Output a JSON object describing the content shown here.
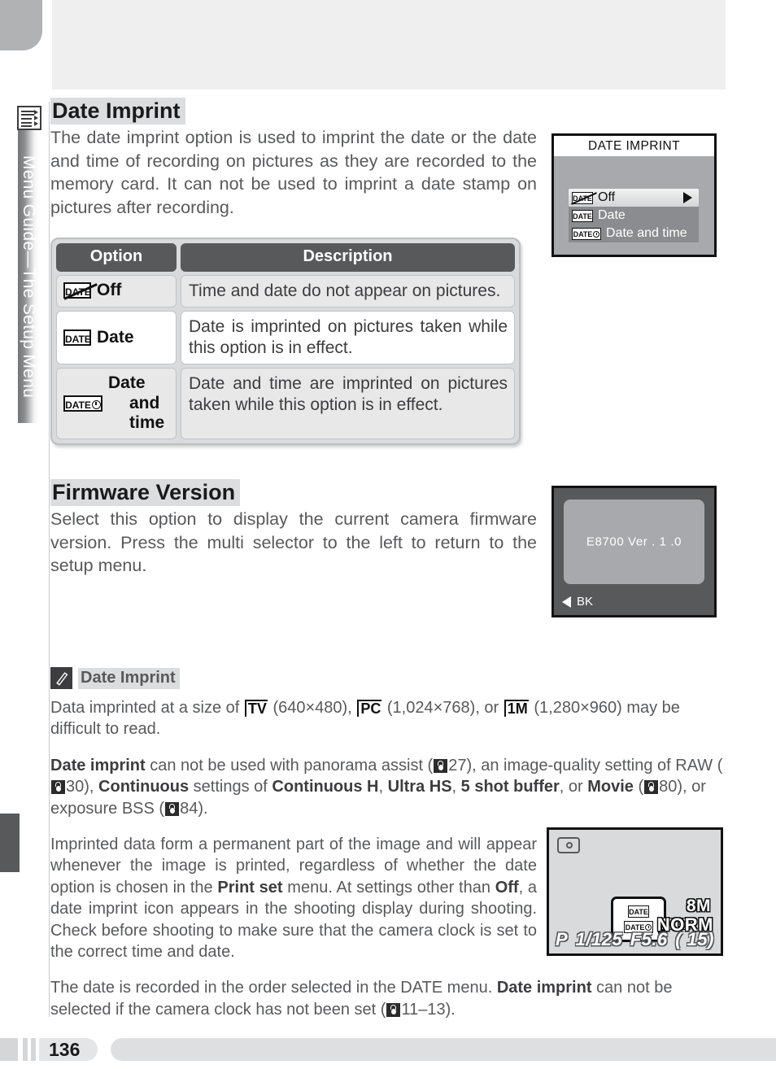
{
  "chapter_tab": {
    "label": "Menu Guide—The Setup Menu",
    "icon": "menu-list-icon"
  },
  "sections": {
    "date_imprint": {
      "heading": "Date Imprint",
      "body": "The date imprint option is used to imprint the date or the date and time of recording on pictures as they are recorded to the memory card.  It can not be used to imprint a date stamp on pictures after recording."
    },
    "firmware_version": {
      "heading": "Firmware Version",
      "body": "Select this option to display the current camera firmware version.  Press the multi selector to the left to return to the setup menu."
    }
  },
  "option_table": {
    "headers": {
      "option": "Option",
      "description": "Description"
    },
    "rows": [
      {
        "icon": "date-off-icon",
        "option": "Off",
        "option_line2": "",
        "description": "Time and date do not appear on pictures."
      },
      {
        "icon": "date-icon",
        "option": "Date",
        "option_line2": "",
        "description": "Date is imprinted on pictures taken while this option is in effect."
      },
      {
        "icon": "date-and-time-icon",
        "option": "Date",
        "option_line2": "and time",
        "description": "Date and time are imprinted on pictures taken while this option is in effect."
      }
    ]
  },
  "lcd_menu": {
    "title": "DATE IMPRINT",
    "items": [
      {
        "icon": "date-off-icon",
        "label": "Off",
        "selected": true,
        "arrow": "▶"
      },
      {
        "icon": "date-icon",
        "label": "Date",
        "selected": false
      },
      {
        "icon": "date-and-time-icon",
        "label": "Date and time",
        "selected": false
      }
    ]
  },
  "lcd_firmware": {
    "version_text": "E8700   Ver . 1 .0",
    "back_label": "BK",
    "back_arrow": "◀"
  },
  "lcd_shooting": {
    "camera_icon": "camera-icon",
    "callout_icons": [
      "date-icon",
      "date-and-time-icon"
    ],
    "active_indicator": "date-and-time-icon",
    "image_size": "8M",
    "quality": "NORM",
    "mode": "P",
    "shutter": "1/125",
    "aperture": "F5.6",
    "frames_remaining": "(     15)"
  },
  "note": {
    "icon": "pencil-icon",
    "title": "Date Imprint",
    "paragraph1_parts": {
      "a": "Data imprinted at a size of ",
      "tag1": "TV",
      "b": " (640×480), ",
      "tag2": "PC",
      "c": " (1,024×768), or ",
      "tag3": "1M",
      "d": " (1,280×960) may be difficult to read."
    },
    "paragraph2_parts": {
      "b1": "Date imprint",
      "a": " can not be used with panorama assist (",
      "p1": "27",
      "b": "), an image-quality setting of RAW (",
      "p2": "30",
      "c": "), ",
      "b2": "Continuous",
      "d": " settings of ",
      "b3": "Continuous H",
      "e": ", ",
      "b4": "Ultra HS",
      "f": ", ",
      "b5": "5 shot buffer",
      "g": ", or ",
      "b6": "Movie",
      "h": " (",
      "p3": "80",
      "i": "), or exposure BSS (",
      "p4": "84",
      "j": ")."
    },
    "paragraph3_parts": {
      "a": "Imprinted data form a permanent part of the image and will appear whenever the image is printed, regardless of whether the date option is chosen in the ",
      "b1": "Print set",
      "b": " menu.  At settings other than ",
      "b2": "Off",
      "c": ", a date imprint icon appears in the shooting display during shooting.  Check before shooting to make sure that the camera clock is set to the correct time and date."
    },
    "paragraph4_parts": {
      "a": "The date is recorded in the order selected in the DATE menu.  ",
      "b1": "Date imprint",
      "b": " can not be selected if the camera clock has not been set (",
      "p1": "11–13",
      "c": ")."
    }
  },
  "footer": {
    "page_number": "136"
  }
}
